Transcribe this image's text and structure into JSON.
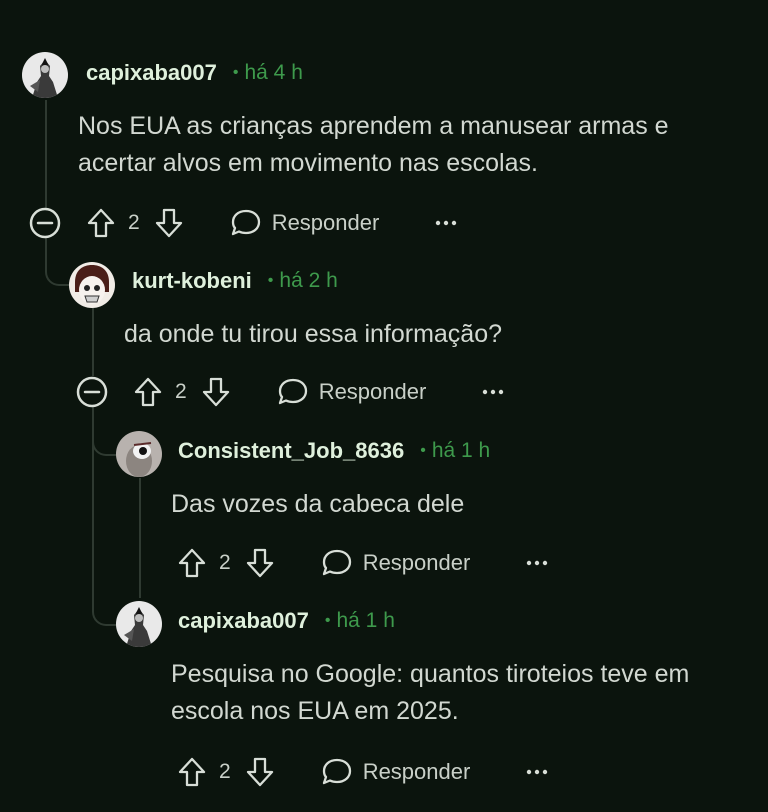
{
  "comments": [
    {
      "username": "capixaba007",
      "separator": "•",
      "time": "há 4 h",
      "lines": [
        "Nos EUA as crianças aprendem a manusear armas e",
        "acertar alvos em movimento nas escolas."
      ],
      "votes": "2",
      "reply_label": "Responder",
      "collapse_icon": "minus-circle-icon",
      "more_icon": "ellipsis-icon"
    },
    {
      "username": "kurt-kobeni",
      "separator": "•",
      "time": "há 2 h",
      "lines": [
        "da onde tu tirou essa informação?"
      ],
      "votes": "2",
      "reply_label": "Responder",
      "collapse_icon": "minus-circle-icon",
      "more_icon": "ellipsis-icon"
    },
    {
      "username": "Consistent_Job_8636",
      "separator": "•",
      "time": "há 1 h",
      "lines": [
        "Das vozes da cabeca dele"
      ],
      "votes": "2",
      "reply_label": "Responder",
      "more_icon": "ellipsis-icon"
    },
    {
      "username": "capixaba007",
      "separator": "•",
      "time": "há 1 h",
      "lines": [
        "Pesquisa no Google: quantos tiroteios teve em",
        "escola nos EUA em 2025."
      ],
      "votes": "2",
      "reply_label": "Responder",
      "more_icon": "ellipsis-icon"
    }
  ],
  "colors": {
    "background": "#0b140d",
    "accent_green": "#3e9a4c",
    "username": "#dff0dc",
    "text": "#d2d8d1",
    "thread_line": "#2f3a31"
  }
}
